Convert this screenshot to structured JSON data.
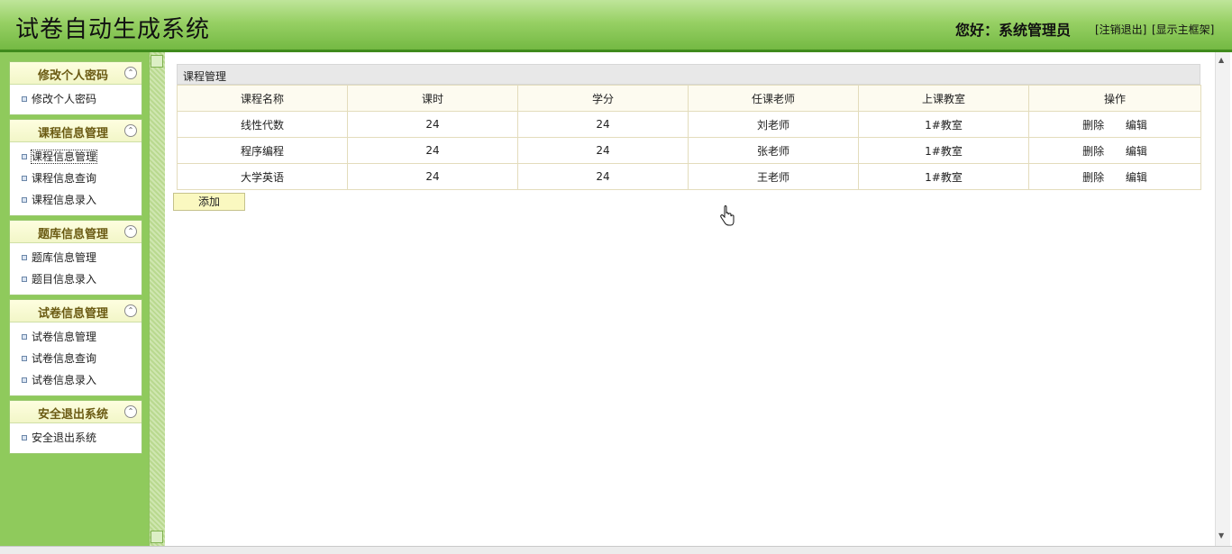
{
  "header": {
    "app_title": "试卷自动生成系统",
    "greeting": "您好：系统管理员",
    "logout_link": "[注销退出]",
    "show_frame_link": "[显示主框架]"
  },
  "sidebar": {
    "panels": [
      {
        "title": "修改个人密码",
        "items": [
          "修改个人密码"
        ]
      },
      {
        "title": "课程信息管理",
        "items": [
          "课程信息管理",
          "课程信息查询",
          "课程信息录入"
        ]
      },
      {
        "title": "题库信息管理",
        "items": [
          "题库信息管理",
          "题目信息录入"
        ]
      },
      {
        "title": "试卷信息管理",
        "items": [
          "试卷信息管理",
          "试卷信息查询",
          "试卷信息录入"
        ]
      },
      {
        "title": "安全退出系统",
        "items": [
          "安全退出系统"
        ]
      }
    ],
    "toggle_glyph": "⌃"
  },
  "main": {
    "section_title": "课程管理",
    "table": {
      "headers": [
        "课程名称",
        "课时",
        "学分",
        "任课老师",
        "上课教室",
        "操作"
      ],
      "rows": [
        {
          "name": "线性代数",
          "hours": "24",
          "credits": "24",
          "teacher": "刘老师",
          "room": "1#教室",
          "delete": "删除",
          "edit": "编辑"
        },
        {
          "name": "程序编程",
          "hours": "24",
          "credits": "24",
          "teacher": "张老师",
          "room": "1#教室",
          "delete": "删除",
          "edit": "编辑"
        },
        {
          "name": "大学英语",
          "hours": "24",
          "credits": "24",
          "teacher": "王老师",
          "room": "1#教室",
          "delete": "删除",
          "edit": "编辑"
        }
      ]
    },
    "add_button": "添加"
  },
  "colors": {
    "header_green": "#74b943",
    "sidebar_green": "#8fca5c",
    "panel_title_text": "#6a5a12",
    "add_button_bg": "#faf8c0"
  },
  "icons": {
    "panel_toggle": "collapse-up-icon",
    "item_bullet": "square-bullet-icon",
    "cursor": "hand-pointer-icon"
  }
}
